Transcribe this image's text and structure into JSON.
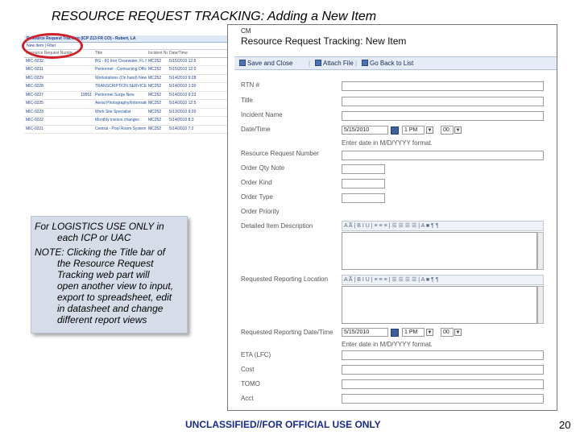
{
  "slide": {
    "title": "RESOURCE REQUEST TRACKING: Adding a New Item",
    "footer": "UNCLASSIFIED//FOR OFFICIAL USE ONLY",
    "page_number": "20"
  },
  "callout": {
    "line1a": "For LOGISTICS USE ONLY in",
    "line1b": "each ICP or UAC",
    "line2a": "NOTE:  Clicking the Title bar of",
    "line2b": "the Resource Request",
    "line2c": "Tracking web part will",
    "line2d": "open another view to input,",
    "line2e": "export to spreadsheet, edit",
    "line2f": "in datasheet and change",
    "line2g": "different report views"
  },
  "list_view": {
    "header": "Resource Request Tracking (ICP 213 FR CO) - Rubert, LA",
    "toolbar": "New Item  |  Filter",
    "columns": [
      "Resource Request Number",
      "",
      "Title",
      "Incident Name",
      "Date/Time"
    ],
    "rows": [
      [
        "MIC-0232",
        "",
        "BG - 60 Iron Clearwater, FL Heliline, Al New",
        "MC252",
        "5/15/2010 12:5"
      ],
      [
        "MIC-0231",
        "",
        "Personnel - Contracting Officers from SLC New",
        "MC252",
        "5/15/2010 12:0"
      ],
      [
        "MIC-0229",
        "",
        "Workstations (On hand) New",
        "MC252",
        "5/14/2010 9:28"
      ],
      [
        "MIC-0228",
        "",
        "TRANSCRIPTION SERVICES New",
        "MC252",
        "5/14/2010 1:30"
      ],
      [
        "MIC-0227",
        "19551",
        "Personnel Surge New",
        "MC252",
        "5/14/2010 9:23"
      ],
      [
        "MIC-0225",
        "",
        "Aerial Photography/Information New",
        "MC252",
        "5/14/2010 12:5"
      ],
      [
        "MIC-0223",
        "",
        "Work Site Specialist",
        "MC252",
        "5/13/2010 9:20"
      ],
      [
        "MIC-0222",
        "",
        "Monthly invoice changes",
        "MC252",
        "5/14/2010 8:3"
      ],
      [
        "MIC-0221",
        "",
        "Central - Pool Room System",
        "MC252",
        "5/14/2010 7:2"
      ]
    ]
  },
  "form": {
    "site_label": "CM",
    "title": "Resource Request Tracking: New Item",
    "toolbar": {
      "save": "Save and Close",
      "attach": "Attach File",
      "back": "Go Back to List"
    },
    "fields": {
      "rtn": "RTN #",
      "title": "Title",
      "incident": "Incident Name",
      "datetime": "Date/Time",
      "rr_number": "Resource Request Number",
      "order_qty": "Order Qty Note",
      "order_kind": "Order Kind",
      "order_type": "Order Type",
      "order_priority": "Order Priority",
      "detailed_desc": "Detailed Item Description",
      "req_location": "Requested Reporting Location",
      "req_datetime": "Requested Reporting Date/Time",
      "eta": "ETA (LFC)",
      "cost": "Cost",
      "tomo": "TOMO",
      "acct": "Acct"
    },
    "date_value": "5/15/2010",
    "hour_value": "1 PM",
    "minute_value": "00",
    "date_hint": "Enter date in M/D/YYYY format.",
    "rte_toolbar": "A  A̅  |  B  I  U  |  ≡ ≡ ≡  |  ☰ ☰ ☰ ☰  |  A  ■  ¶  ¶"
  }
}
